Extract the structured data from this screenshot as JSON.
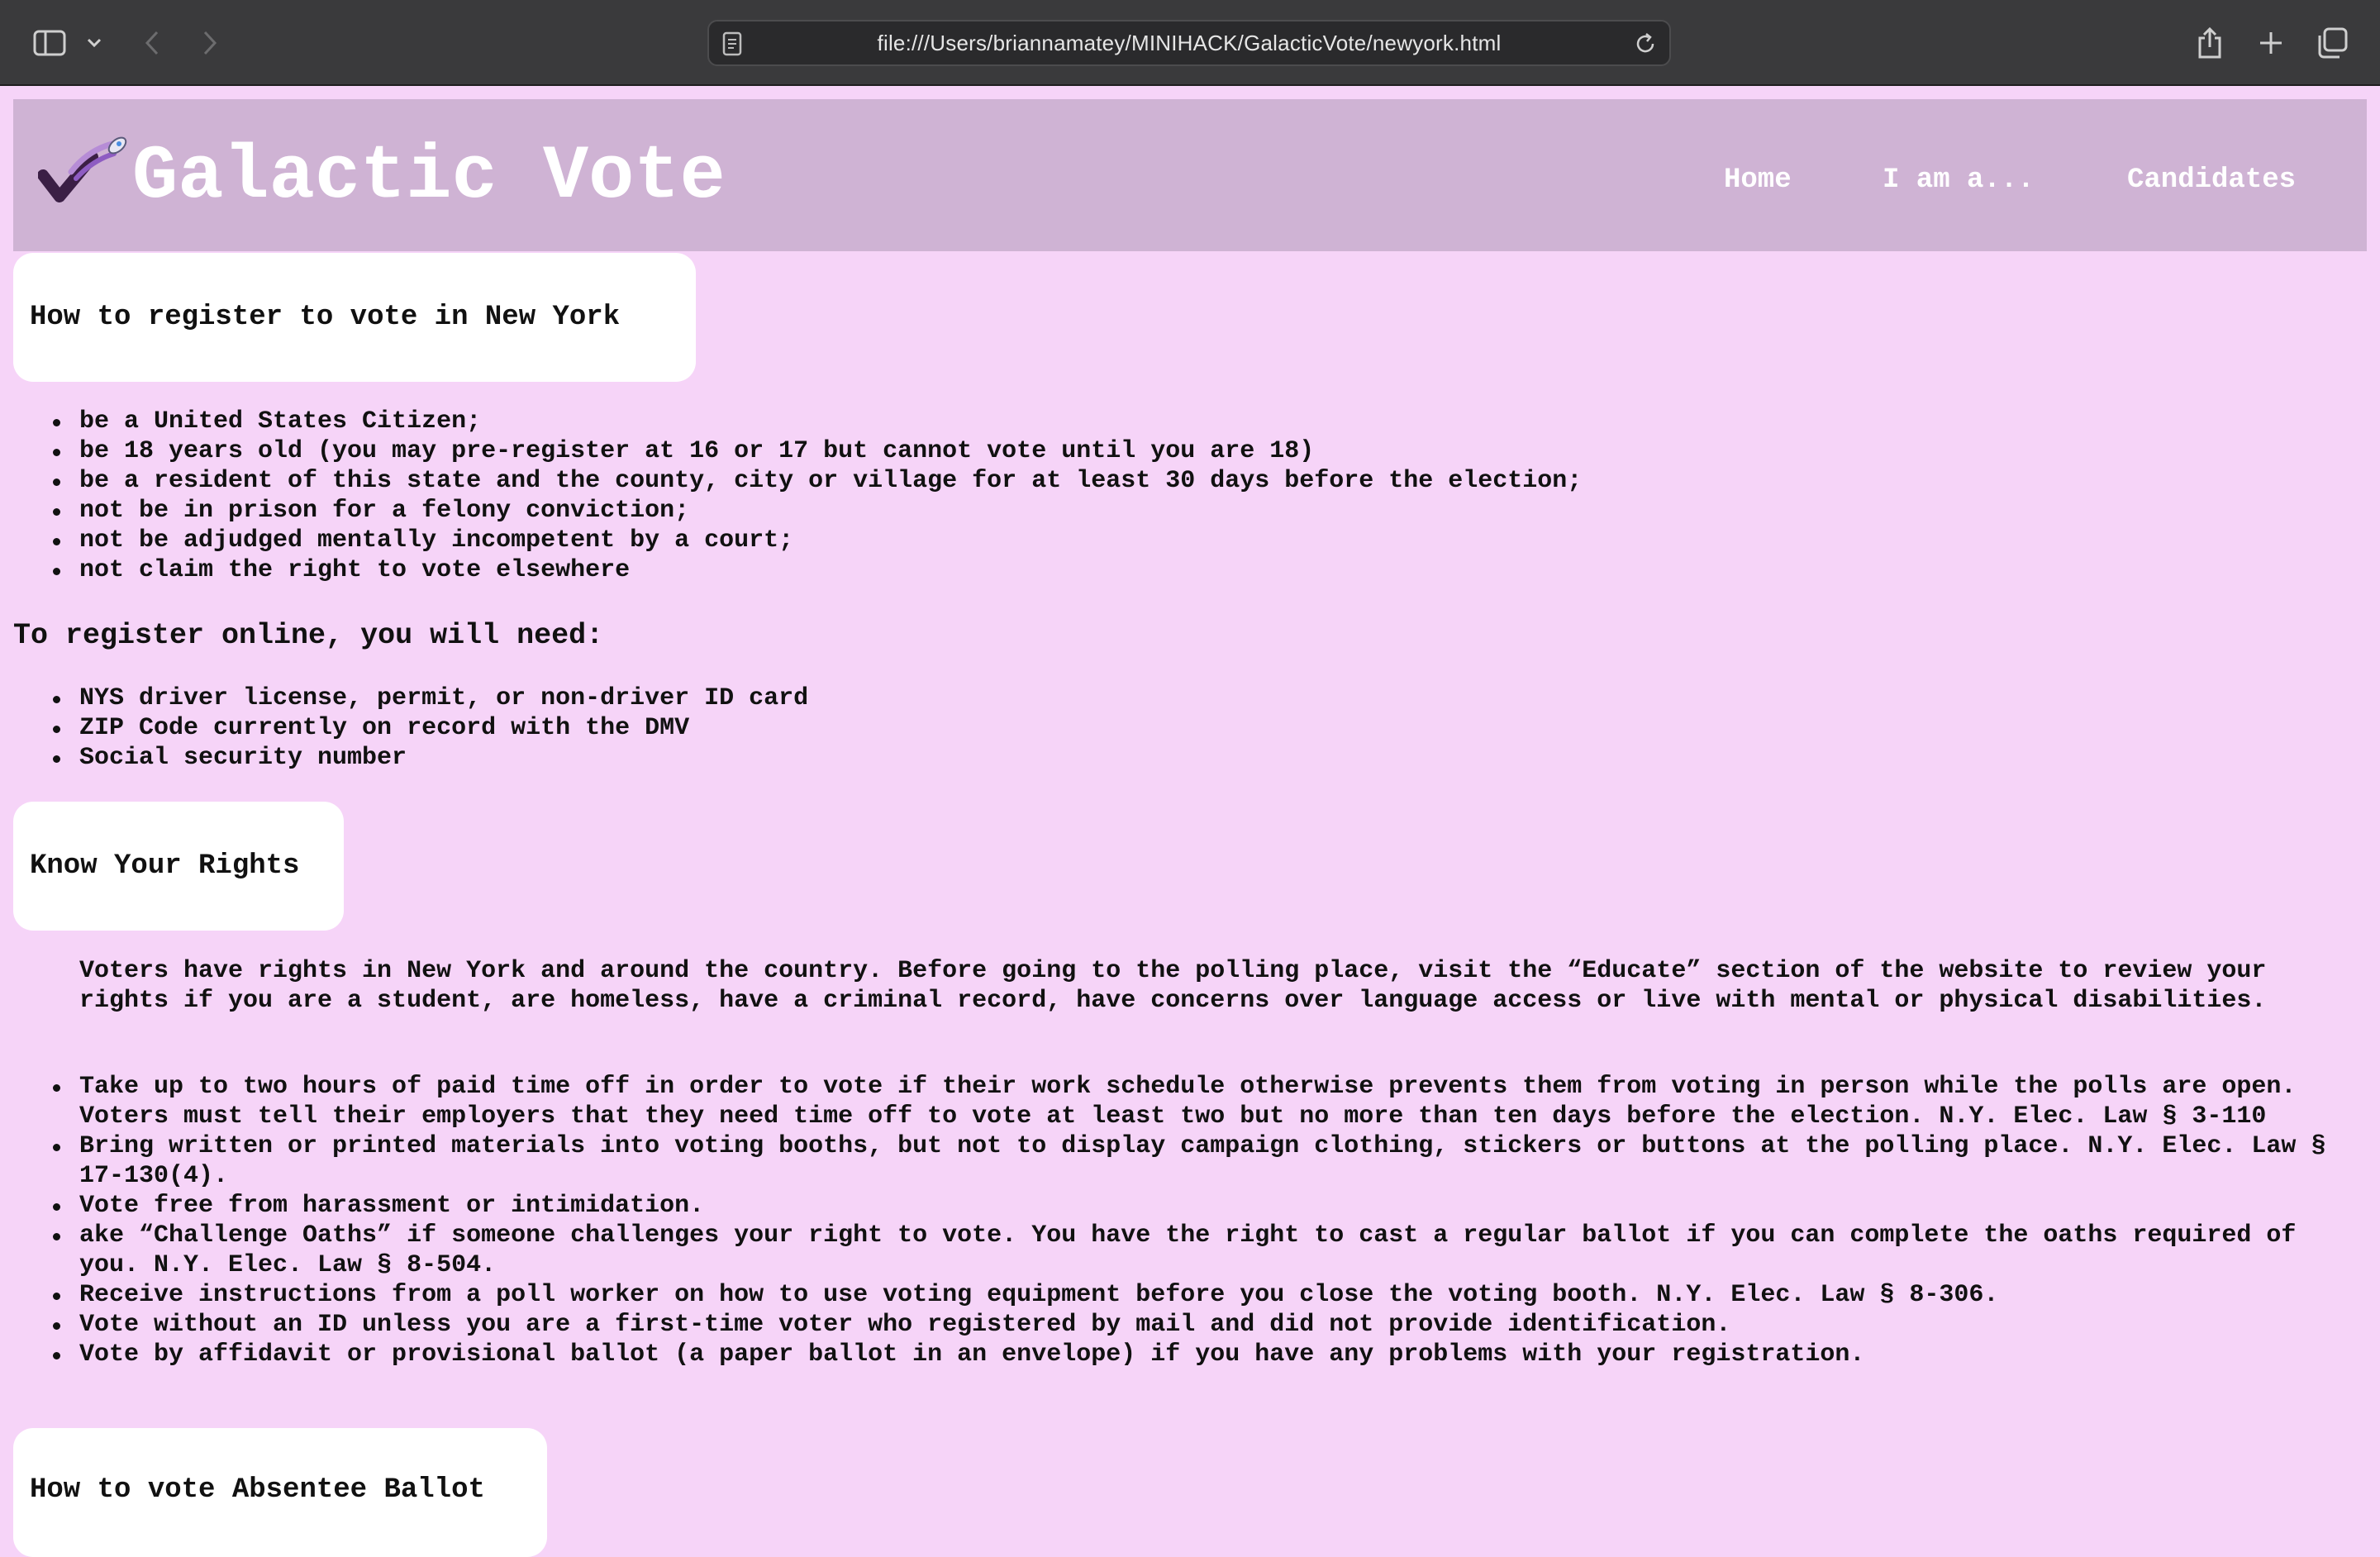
{
  "browser": {
    "url": "file:///Users/briannamatey/MINIHACK/GalacticVote/newyork.html"
  },
  "header": {
    "site_title": "Galactic Vote",
    "nav": [
      "Home",
      "I am a...",
      "Candidates"
    ]
  },
  "register": {
    "heading": "How to register to vote in New York",
    "requirements": [
      "be a United States Citizen;",
      "be 18 years old (you may pre-register at 16 or 17 but cannot vote until you are 18)",
      "be a resident of this state and the county, city or village for at least 30 days before the election;",
      "not be in prison for a felony conviction;",
      "not be adjudged mentally incompetent by a court;",
      "not claim the right to vote elsewhere"
    ],
    "online_heading": "To register online, you will need:",
    "online_needs": [
      "NYS driver license, permit, or non-driver ID card",
      "ZIP Code currently on record with the DMV",
      "Social security number"
    ]
  },
  "rights": {
    "heading": "Know Your Rights",
    "intro": "Voters have rights in New York and around the country. Before going to the polling place, visit the “Educate” section of the website to review your rights if you are a student, are homeless, have a criminal record, have concerns over language access or live with mental or physical disabilities.",
    "items": [
      "Take up to two hours of paid time off in order to vote if their work schedule otherwise prevents them from voting in person while the polls are open. Voters must tell their employers that they need time off to vote at least two but no more than ten days before the election. N.Y. Elec. Law § 3-110",
      "Bring written or printed materials into voting booths, but not to display campaign clothing, stickers or buttons at the polling place. N.Y. Elec. Law § 17-130(4).",
      "Vote free from harassment or intimidation.",
      "ake “Challenge Oaths” if someone challenges your right to vote. You have the right to cast a regular ballot if you can complete the oaths required of you. N.Y. Elec. Law § 8-504.",
      "Receive instructions from a poll worker on how to use voting equipment before you close the voting booth. N.Y. Elec. Law § 8-306.",
      "Vote without an ID unless you are a first-time voter who registered by mail and did not provide identification.",
      "Vote by affidavit or provisional ballot (a paper ballot in an envelope) if you have any problems with your registration."
    ]
  },
  "absentee": {
    "heading": "How to vote Absentee Ballot"
  }
}
